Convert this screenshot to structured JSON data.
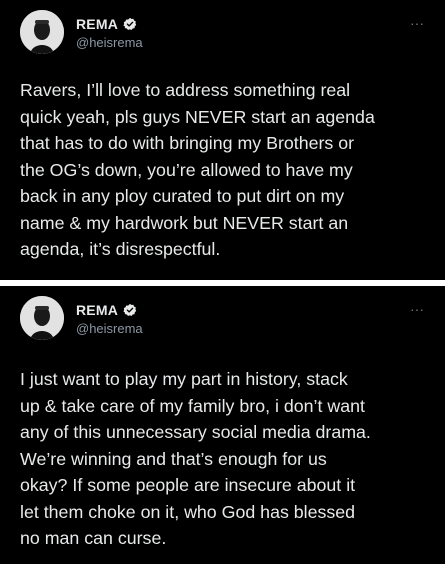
{
  "tweets": [
    {
      "author": {
        "display_name": "REMA",
        "handle": "@heisrema",
        "verified": true,
        "avatar_icon": "avatar-photo-icon"
      },
      "menu_icon": "more-options-icon",
      "text": "Ravers, I’ll love to address something real\nquick yeah, pls guys NEVER start an agenda\nthat has to do with bringing my Brothers or\nthe OG’s down, you’re allowed to have my\nback in any ploy curated to put dirt on my\nname & my hardwork but NEVER start an\nagenda, it’s disrespectful."
    },
    {
      "author": {
        "display_name": "REMA",
        "handle": "@heisrema",
        "verified": true,
        "avatar_icon": "avatar-photo-icon"
      },
      "menu_icon": "more-options-icon",
      "text": "I just want to play my part in history, stack\nup & take care of my family bro, i don’t want\nany of this unnecessary social media drama.\nWe’re winning and that’s enough for us\nokay? If some people are insecure about it\nlet them choke on it, who God has blessed\nno man can curse."
    }
  ],
  "colors": {
    "background": "#000000",
    "separator": "#ffffff",
    "text": "#e7e9ea",
    "secondary_text": "#8b98a5",
    "verified_badge": "#e7e9ea"
  }
}
